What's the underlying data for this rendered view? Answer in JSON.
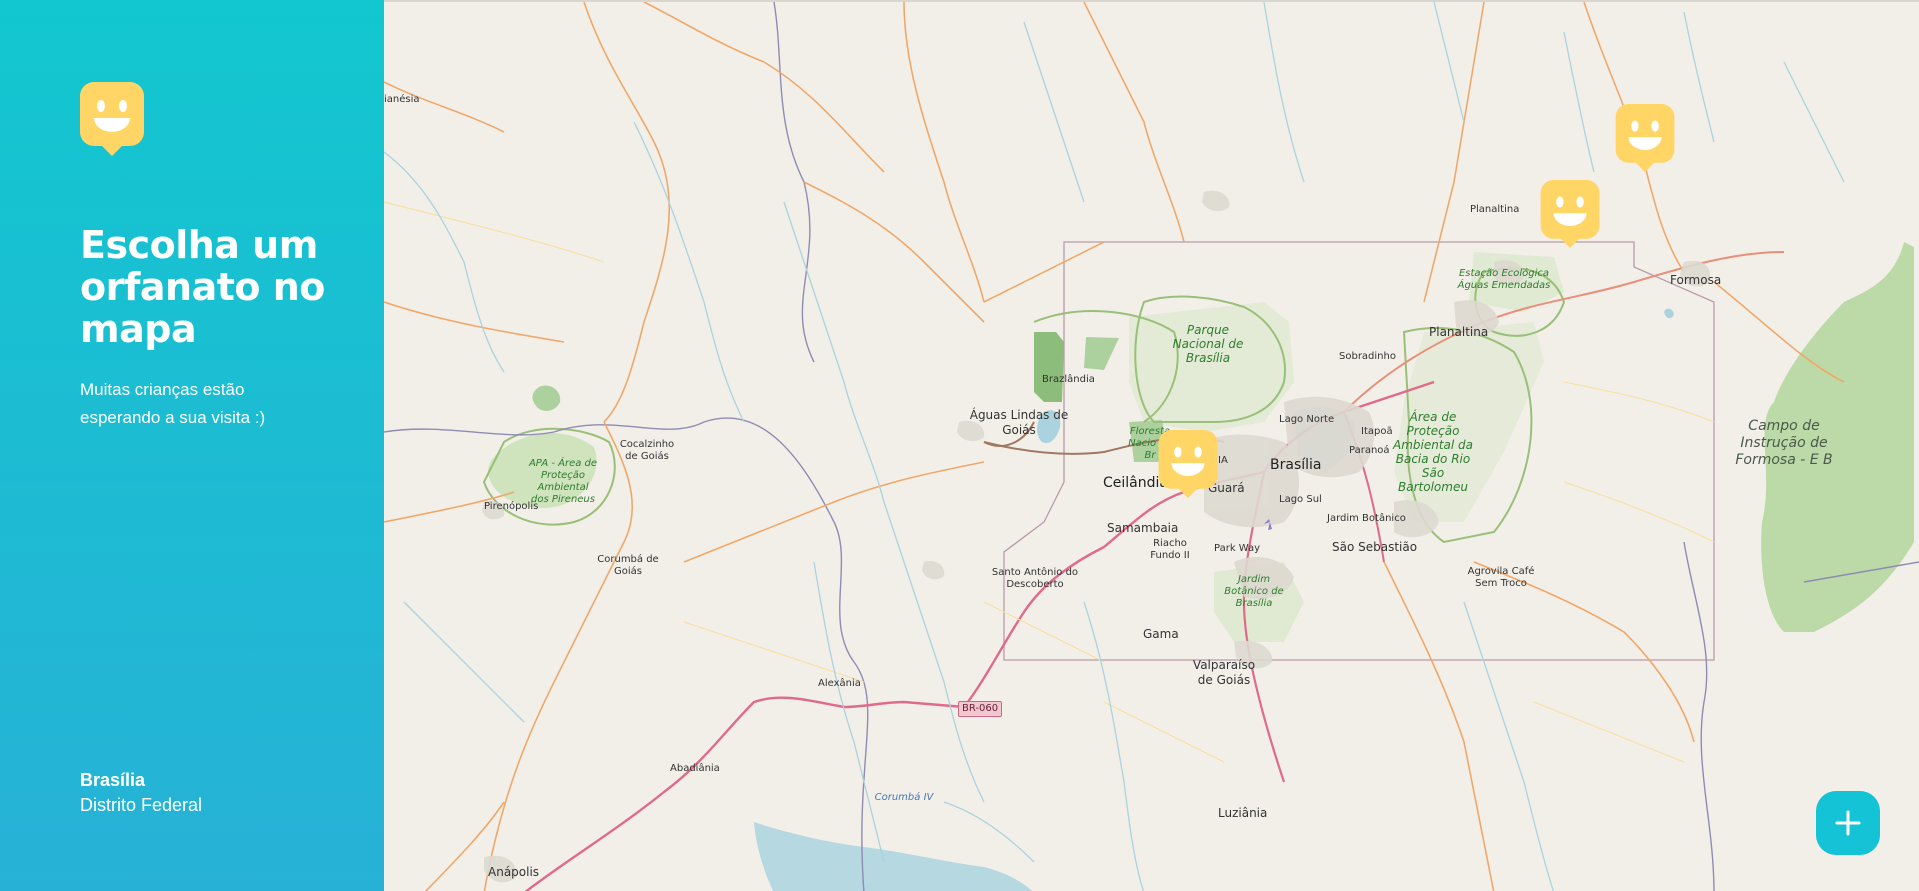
{
  "sidebar": {
    "logo_icon": "smiley-map-pin-icon",
    "title": "Escolha um orfanato no mapa",
    "subtitle": "Muitas crianças estão esperando a sua visita :)",
    "location_city": "Brasília",
    "location_state": "Distrito Federal",
    "gradient_top": "#12c7cf",
    "gradient_bottom": "#27b1d6"
  },
  "map": {
    "labels": {
      "anapolis": "Anápolis",
      "abadiania": "Abadiânia",
      "alexania": "Alexânia",
      "aguas_lindas": "Águas Lindas de Goiás",
      "brazlandia": "Brazlândia",
      "cocalzinho": "Cocalzinho de Goiás",
      "pirenopolis": "Pirenópolis",
      "corumba": "Corumbá de Goiás",
      "santo_antonio": "Santo Antônio do Descoberto",
      "ceilandia": "Ceilândia",
      "samambaia": "Samambaia",
      "riacho_fundo": "Riacho Fundo II",
      "guara": "Guará",
      "brasilia": "Brasília",
      "lago_norte": "Lago Norte",
      "lago_sul": "Lago Sul",
      "itapoa": "Itapoã",
      "paranoa": "Paranoá",
      "park_way": "Park Way",
      "jardim_botanico": "Jardim Botânico",
      "sao_sebastiao": "São Sebastião",
      "gama": "Gama",
      "valparaiso": "Valparaíso de Goiás",
      "luziania": "Luziânia",
      "sobradinho": "Sobradinho",
      "planaltina_df": "Planaltina",
      "planaltina_go": "Planaltina",
      "formosa": "Formosa",
      "agrovila": "Agrovila Café Sem Troco",
      "ia_partial": "IA",
      "anesia_partial": "ianésia",
      "parque_nacional": "Parque Nacional de Brasília",
      "floresta_nacional": "Floresta Nacio de Br",
      "apa_pireneus": "APA - Área de Proteção Ambiental dos Pireneus",
      "estacao_ecologica": "Estação Ecológica Águas Emendadas",
      "area_protecao": "Área de Proteção Ambiental da Bacia do Rio São Bartolomeu",
      "jardim_botanico_park": "Jardim Botânico de Brasília",
      "campo_instrucao": "Campo de Instrução de Formosa - E B",
      "corumba_iv": "Corumbá IV",
      "br060": "BR-060"
    },
    "markers": [
      {
        "name": "orphanage-marker",
        "icon": "smiley-map-pin-icon"
      },
      {
        "name": "orphanage-marker",
        "icon": "smiley-map-pin-icon"
      },
      {
        "name": "orphanage-marker",
        "icon": "smiley-map-pin-icon"
      }
    ],
    "marker_color": "#ffd666"
  },
  "add_button": {
    "icon": "plus-icon",
    "color": "#15c3d6"
  }
}
